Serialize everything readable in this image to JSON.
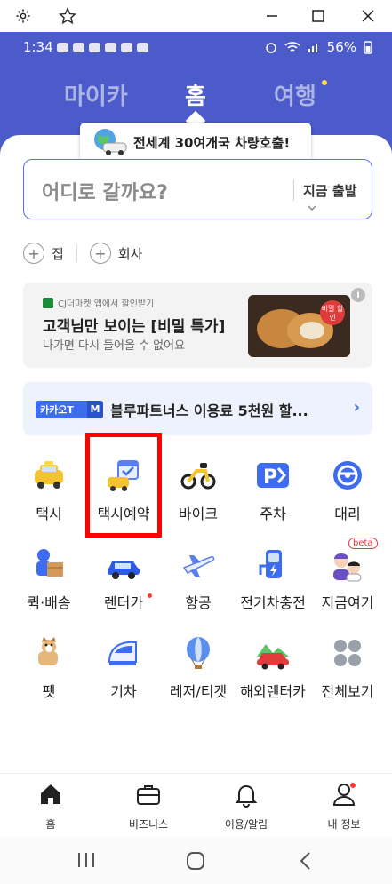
{
  "window": {
    "settings_icon": "gear-icon",
    "star_icon": "star-icon",
    "minimize_icon": "minimize-icon",
    "maximize_icon": "maximize-icon",
    "close_icon": "close-icon"
  },
  "status_bar": {
    "time": "1:34",
    "battery": "56%"
  },
  "top_tabs": [
    {
      "label": "마이카"
    },
    {
      "label": "홈"
    },
    {
      "label": "여행"
    }
  ],
  "bubble": {
    "text": "전세계 30여개국 차량호출!"
  },
  "search": {
    "placeholder": "어디로 갈까요?",
    "departure": "지금 출발"
  },
  "quick_places": [
    {
      "label": "집"
    },
    {
      "label": "회사"
    }
  ],
  "ad": {
    "source": "CJ더마켓 앱에서 할인받기",
    "title": "고객님만 보이는 [비밀 특가]",
    "subtitle": "나가면 다시 들어올 수 없어요",
    "badge": "비밀 할인",
    "info_icon": "info-icon"
  },
  "promo": {
    "badge": "카카오T",
    "badge_m": "M",
    "text": "블루파트너스 이용료 5천원 할..."
  },
  "services": [
    {
      "label": "택시"
    },
    {
      "label": "택시예약"
    },
    {
      "label": "바이크"
    },
    {
      "label": "주차"
    },
    {
      "label": "대리"
    },
    {
      "label": "퀵·배송"
    },
    {
      "label": "렌터카"
    },
    {
      "label": "항공"
    },
    {
      "label": "전기차충전"
    },
    {
      "label": "지금여기",
      "badge": "beta"
    },
    {
      "label": "펫"
    },
    {
      "label": "기차"
    },
    {
      "label": "레저/티켓"
    },
    {
      "label": "해외렌터카"
    },
    {
      "label": "전체보기"
    }
  ],
  "bottom_nav": [
    {
      "label": "홈"
    },
    {
      "label": "비즈니스"
    },
    {
      "label": "이용/알림"
    },
    {
      "label": "내 정보"
    }
  ],
  "colors": {
    "brand_blue": "#4b5bc9",
    "accent_blue": "#3d6cf0",
    "highlight_red": "#ff0000"
  }
}
